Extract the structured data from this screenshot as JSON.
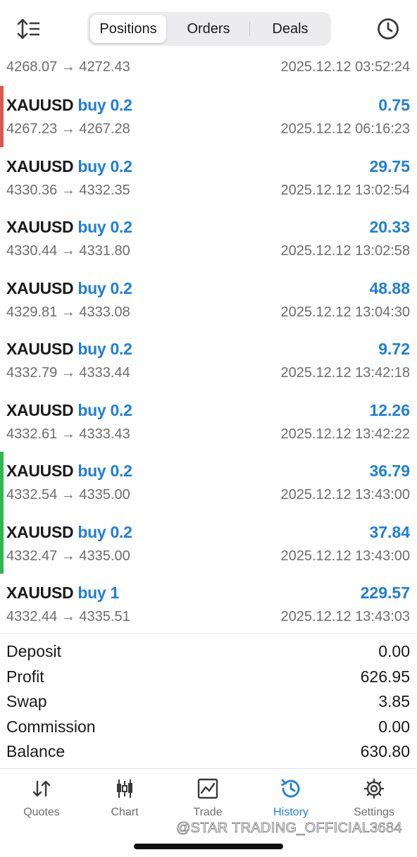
{
  "header": {
    "tabs": [
      {
        "label": "Positions",
        "active": true
      },
      {
        "label": "Orders",
        "active": false
      },
      {
        "label": "Deals",
        "active": false
      }
    ]
  },
  "colors": {
    "accent": "#1e7fd6",
    "marker_red": "#e0564f",
    "marker_green": "#2db84b"
  },
  "deals": [
    {
      "symbol": "",
      "side": "",
      "profit": "",
      "prices": "4268.07 → 4272.43",
      "time": "2025.12.12 03:52:24",
      "marker": ""
    },
    {
      "symbol": "XAUUSD",
      "side": "buy 0.2",
      "profit": "0.75",
      "prices": "4267.23 → 4267.28",
      "time": "2025.12.12 06:16:23",
      "marker": "red"
    },
    {
      "symbol": "XAUUSD",
      "side": "buy 0.2",
      "profit": "29.75",
      "prices": "4330.36 → 4332.35",
      "time": "2025.12.12 13:02:54",
      "marker": ""
    },
    {
      "symbol": "XAUUSD",
      "side": "buy 0.2",
      "profit": "20.33",
      "prices": "4330.44 → 4331.80",
      "time": "2025.12.12 13:02:58",
      "marker": ""
    },
    {
      "symbol": "XAUUSD",
      "side": "buy 0.2",
      "profit": "48.88",
      "prices": "4329.81 → 4333.08",
      "time": "2025.12.12 13:04:30",
      "marker": ""
    },
    {
      "symbol": "XAUUSD",
      "side": "buy 0.2",
      "profit": "9.72",
      "prices": "4332.79 → 4333.44",
      "time": "2025.12.12 13:42:18",
      "marker": ""
    },
    {
      "symbol": "XAUUSD",
      "side": "buy 0.2",
      "profit": "12.26",
      "prices": "4332.61 → 4333.43",
      "time": "2025.12.12 13:42:22",
      "marker": ""
    },
    {
      "symbol": "XAUUSD",
      "side": "buy 0.2",
      "profit": "36.79",
      "prices": "4332.54 → 4335.00",
      "time": "2025.12.12 13:43:00",
      "marker": "green"
    },
    {
      "symbol": "XAUUSD",
      "side": "buy 0.2",
      "profit": "37.84",
      "prices": "4332.47 → 4335.00",
      "time": "2025.12.12 13:43:00",
      "marker": "green"
    },
    {
      "symbol": "XAUUSD",
      "side": "buy 1",
      "profit": "229.57",
      "prices": "4332.44 → 4335.51",
      "time": "2025.12.12 13:43:03",
      "marker": ""
    }
  ],
  "summary": [
    {
      "label": "Deposit",
      "value": "0.00"
    },
    {
      "label": "Profit",
      "value": "626.95"
    },
    {
      "label": "Swap",
      "value": "3.85"
    },
    {
      "label": "Commission",
      "value": "0.00"
    },
    {
      "label": "Balance",
      "value": "630.80"
    }
  ],
  "tabbar": [
    {
      "label": "Quotes",
      "icon": "quotes-icon",
      "active": false
    },
    {
      "label": "Chart",
      "icon": "chart-icon",
      "active": false
    },
    {
      "label": "Trade",
      "icon": "trade-icon",
      "active": false
    },
    {
      "label": "History",
      "icon": "history-icon",
      "active": true
    },
    {
      "label": "Settings",
      "icon": "settings-icon",
      "active": false
    }
  ],
  "watermark": "@STAR TRADING_OFFICIAL3684"
}
